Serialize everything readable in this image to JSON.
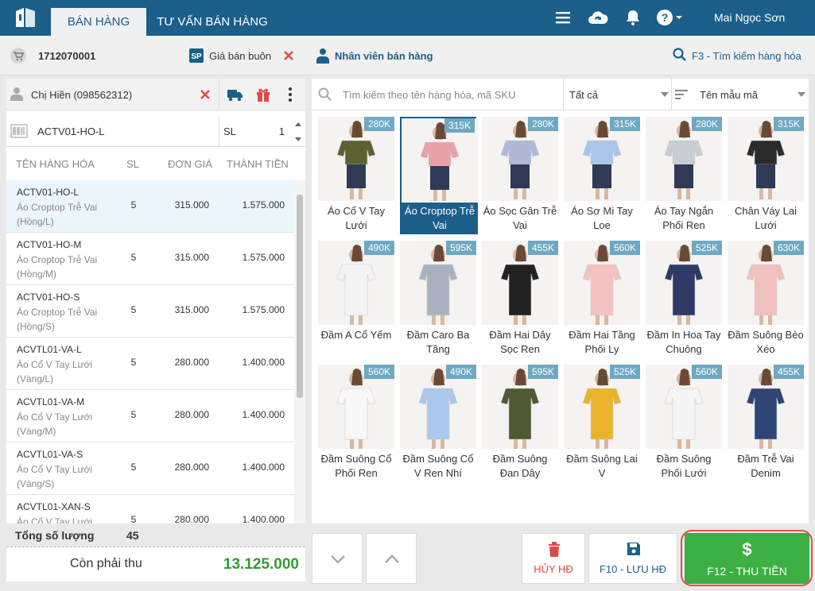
{
  "header": {
    "tabs": [
      {
        "label": "BÁN HÀNG"
      },
      {
        "label": "TƯ VẤN BÁN HÀNG"
      }
    ],
    "user": "Mai Ngọc Sơn"
  },
  "subbar": {
    "invoice_code": "1712070001",
    "price_list": "Giá bán buôn",
    "staff": "Nhân viên bán hàng",
    "search_hint": "F3 - Tìm kiếm hàng hóa"
  },
  "customer": {
    "name": "Chị Hiền (098562312)"
  },
  "item_input": {
    "code": "ACTV01-HO-L",
    "qty_label": "SL",
    "qty": "1"
  },
  "table": {
    "headers": {
      "name": "TÊN HÀNG HÓA",
      "qty": "SL",
      "price": "ĐƠN GIÁ",
      "total": "THÀNH TIỀN"
    },
    "rows": [
      {
        "code": "ACTV01-HO-L",
        "name": "Áo Croptop Trễ Vai (Hồng/L)",
        "qty": "5",
        "price": "315.000",
        "total": "1.575.000"
      },
      {
        "code": "ACTV01-HO-M",
        "name": "Áo Croptop Trễ Vai (Hồng/M)",
        "qty": "5",
        "price": "315.000",
        "total": "1.575.000"
      },
      {
        "code": "ACTV01-HO-S",
        "name": "Áo Croptop Trễ Vai (Hồng/S)",
        "qty": "5",
        "price": "315.000",
        "total": "1.575.000"
      },
      {
        "code": "ACVTL01-VA-L",
        "name": "Áo Cổ V Tay Lưới (Vàng/L)",
        "qty": "5",
        "price": "280.000",
        "total": "1.400.000"
      },
      {
        "code": "ACVTL01-VA-M",
        "name": "Áo Cổ V Tay Lưới (Vàng/M)",
        "qty": "5",
        "price": "280.000",
        "total": "1.400.000"
      },
      {
        "code": "ACVTL01-VA-S",
        "name": "Áo Cổ V Tay Lưới (Vàng/S)",
        "qty": "5",
        "price": "280.000",
        "total": "1.400.000"
      },
      {
        "code": "ACVTL01-XAN-S",
        "name": "Áo Cổ V Tay Lưới",
        "qty": "5",
        "price": "280.000",
        "total": "1.400.000"
      }
    ]
  },
  "summary": {
    "total_qty_label": "Tổng số lượng",
    "total_qty": "45",
    "due_label": "Còn phải thu",
    "due": "13.125.000"
  },
  "filters": {
    "search_placeholder": "Tìm kiếm theo tên hàng hóa, mã SKU",
    "category": "Tất cả",
    "sort": "Tên mẫu mã"
  },
  "products": [
    {
      "name": "Áo Cổ V Tay Lưới",
      "price": "280K",
      "color": "#5b6132"
    },
    {
      "name": "Áo Croptop Trễ Vai",
      "price": "315K",
      "color": "#e9a1a8",
      "selected": true
    },
    {
      "name": "Áo Sọc Gân Trễ Vai",
      "price": "280K",
      "color": "#aeb9d6"
    },
    {
      "name": "Áo Sơ Mi Tay Loe",
      "price": "315K",
      "color": "#a9c6e8"
    },
    {
      "name": "Áo Tay Ngắn Phối Ren",
      "price": "280K",
      "color": "#c9ccd3"
    },
    {
      "name": "Chân Váy Lai Lưới",
      "price": "315K",
      "color": "#2b2b2b"
    },
    {
      "name": "Đầm A Cổ Yếm",
      "price": "490K",
      "color": "#f4f4f4"
    },
    {
      "name": "Đầm Caro Ba Tầng",
      "price": "595K",
      "color": "#a9b0c0"
    },
    {
      "name": "Đầm Hai Dây Sọc Ren",
      "price": "455K",
      "color": "#222222"
    },
    {
      "name": "Đầm Hai Tầng Phối Ly",
      "price": "560K",
      "color": "#f2c3c1"
    },
    {
      "name": "Đầm In Hoa Tay Chuông",
      "price": "525K",
      "color": "#2e3a66"
    },
    {
      "name": "Đầm Suông Bèo Xéo",
      "price": "630K",
      "color": "#f0c0be"
    },
    {
      "name": "Đầm Suông Cổ Phối Ren",
      "price": "560K",
      "color": "#f7f7f7"
    },
    {
      "name": "Đầm Suông Cổ V Ren Nhí",
      "price": "490K",
      "color": "#a9c8ea"
    },
    {
      "name": "Đầm Suông Đan Dây",
      "price": "595K",
      "color": "#4f5a31"
    },
    {
      "name": "Đầm Suông Lai V",
      "price": "525K",
      "color": "#e7b42c"
    },
    {
      "name": "Đầm Suông Phối Lưới",
      "price": "560K",
      "color": "#f5f5f5"
    },
    {
      "name": "Đầm Trễ Vai Denim",
      "price": "455K",
      "color": "#2f4576"
    }
  ],
  "buttons": {
    "cancel": "HỦY HĐ",
    "save": "F10 - LƯU HĐ",
    "pay": "F12 - THU TIỀN"
  },
  "colors": {
    "brand": "#1b5f8a",
    "pay": "#3cb043",
    "danger": "#e04848",
    "total_green": "#2e9e2e"
  }
}
